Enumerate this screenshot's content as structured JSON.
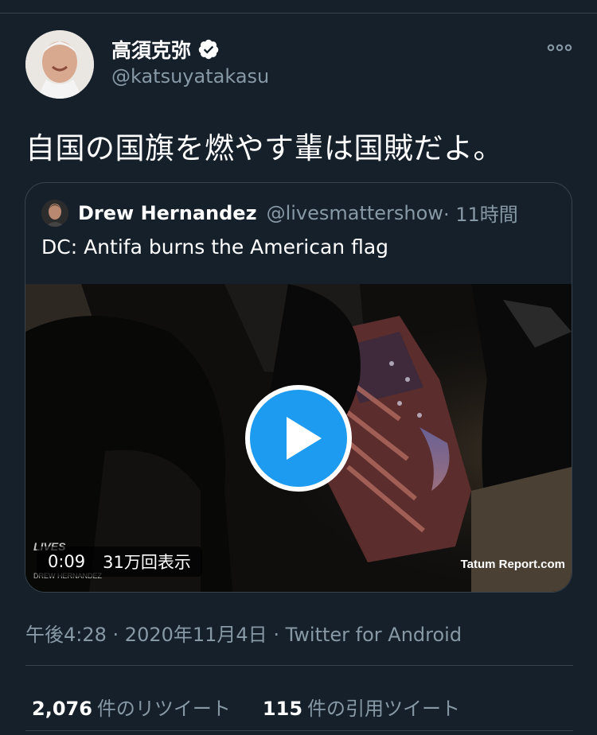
{
  "tweet": {
    "author": {
      "name": "高須克弥",
      "handle": "@katsuyatakasu",
      "verified": true
    },
    "text": "自国の国旗を燃やす輩は国賊だよ。",
    "more_icon": "more-icon",
    "meta": {
      "time": "午後4:28",
      "sep1": " · ",
      "date": "2020年11月4日",
      "sep2": " · ",
      "source": "Twitter for Android"
    },
    "stats": [
      {
        "count": "2,076",
        "label": "件のリツイート"
      },
      {
        "count": "115",
        "label": "件の引用ツイート"
      }
    ]
  },
  "quoted": {
    "author": {
      "name": "Drew Hernandez",
      "handle": "@livesmattershow",
      "time": " · 11時間"
    },
    "text": "DC: Antifa burns the American flag",
    "video": {
      "duration": "0:09",
      "views": "31万回表示",
      "watermark_right": "Tatum Report.com",
      "watermark_left": "LIVES",
      "watermark_left_sub": "DREW HERNANDEZ"
    }
  },
  "colors": {
    "background": "#15202b",
    "secondary_text": "#8899a6",
    "border": "#38444d",
    "play_blue": "#1d9bf0"
  }
}
